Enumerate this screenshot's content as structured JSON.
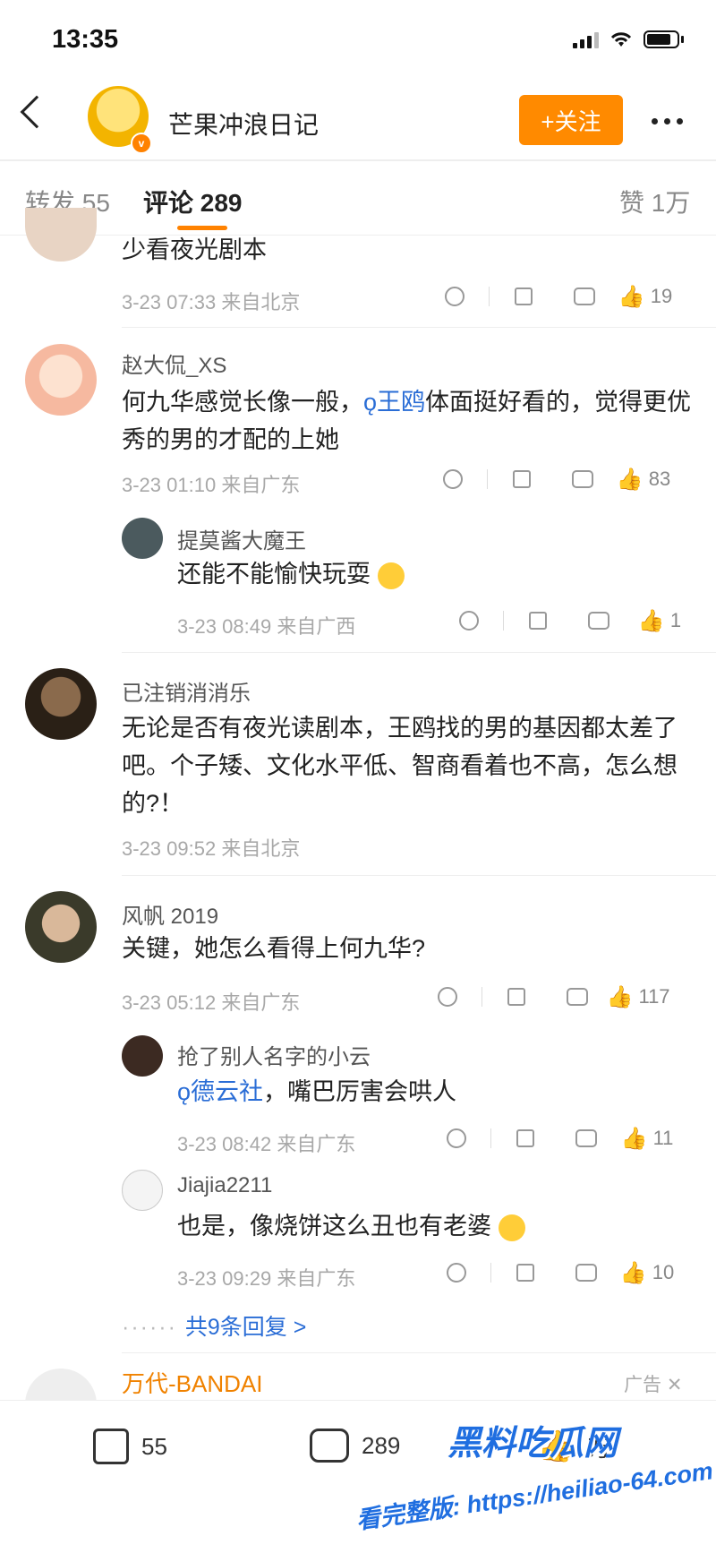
{
  "status_bar": {
    "time": "13:35"
  },
  "header": {
    "account_name": "芒果冲浪日记",
    "follow_label": "+关注"
  },
  "tabs": {
    "repost": "转发 55",
    "comments": "评论 289",
    "likes": "赞 1万"
  },
  "comments": [
    {
      "name": "",
      "text": "少看夜光剧本",
      "time": "3-23 07:33",
      "location": "来自北京",
      "likes": "19"
    },
    {
      "name": "赵大侃_XS",
      "text_pre": "何九华感觉长像一般，",
      "topic": "王鸥",
      "text_post": "体面挺好看的，觉得更优秀的男的才配的上她",
      "time": "3-23 01:10",
      "location": "来自广东",
      "likes": "83",
      "replies": [
        {
          "name": "提莫酱大魔王",
          "text": "还能不能愉快玩耍",
          "time": "3-23 08:49",
          "location": "来自广西",
          "likes": "1"
        }
      ]
    },
    {
      "name": "已注销消消乐",
      "text": "无论是否有夜光读剧本，王鸥找的男的基因都太差了吧。个子矮、文化水平低、智商看着也不高，怎么想的?！",
      "time": "3-23 09:52",
      "location": "来自北京"
    },
    {
      "name": "风帆 2019",
      "text": "关键，她怎么看得上何九华?",
      "time": "3-23 05:12",
      "location": "来自广东",
      "likes": "117",
      "replies": [
        {
          "name": "抢了别人名字的小云",
          "topic": "德云社",
          "text_post": "，嘴巴厉害会哄人",
          "time": "3-23 08:42",
          "location": "来自广东",
          "likes": "11"
        },
        {
          "name": "Jiajia2211",
          "text": "也是，像烧饼这么丑也有老婆",
          "time": "3-23 09:29",
          "location": "来自广东",
          "likes": "10"
        }
      ],
      "more_replies": "共9条回复 >"
    }
  ],
  "ad": {
    "name": "万代-BANDAI",
    "tag": "广告 ✕"
  },
  "bottom_bar": {
    "repost": "55",
    "comment": "289",
    "like": "万"
  },
  "watermark": {
    "line1": "黑料吃瓜网",
    "line2": "看完整版: https://heiliao-64.com"
  }
}
